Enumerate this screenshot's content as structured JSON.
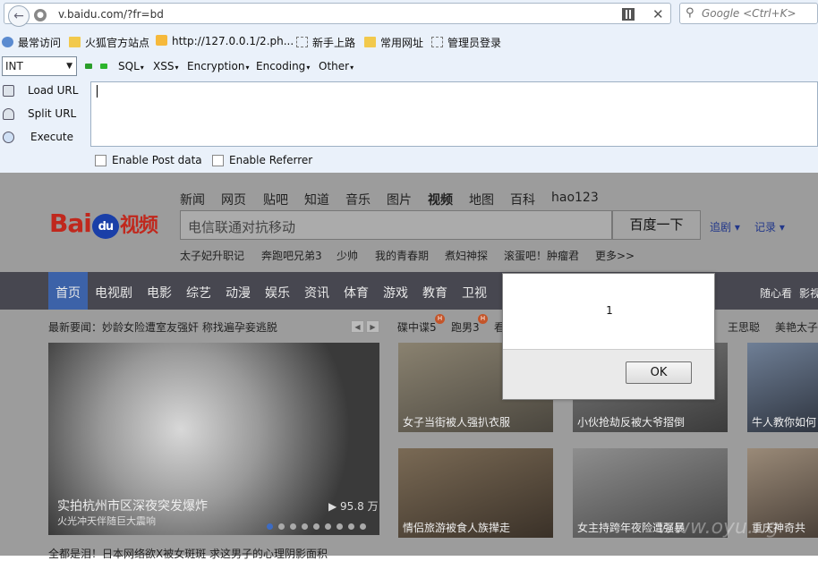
{
  "browser": {
    "url": "v.baidu.com/?fr=bd",
    "search_placeholder": "Google <Ctrl+K>",
    "bookmarks": [
      "最常访问",
      "火狐官方站点",
      "http://127.0.0.1/2.ph...",
      "新手上路",
      "常用网址",
      "管理员登录"
    ]
  },
  "hackbar": {
    "type_select": "INT",
    "menus": [
      "SQL",
      "XSS",
      "Encryption",
      "Encoding",
      "Other"
    ],
    "load_url": "Load URL",
    "split_url": "Split URL",
    "execute": "Execute",
    "textarea_value": "",
    "enable_post": "Enable Post data",
    "enable_referrer": "Enable Referrer"
  },
  "page": {
    "top_nav": [
      "新闻",
      "网页",
      "贴吧",
      "知道",
      "音乐",
      "图片",
      "视频",
      "地图",
      "百科",
      "hao123"
    ],
    "logo": {
      "bai": "Bai",
      "du": "du",
      "shipin": "视频"
    },
    "search_value": "电信联通对抗移动",
    "search_button": "百度一下",
    "link_zhuiju": "追剧 ▾",
    "link_jilu": "记录 ▾",
    "hot_searches": [
      "太子妃升职记",
      "奔跑吧兄弟3",
      "少帅",
      "我的青春期",
      "煮妇神探",
      "滚蛋吧！肿瘤君",
      "更多>>"
    ],
    "channels": [
      "首页",
      "电视剧",
      "电影",
      "综艺",
      "动漫",
      "娱乐",
      "资讯",
      "体育",
      "游戏",
      "教育",
      "卫视"
    ],
    "channels_right": [
      "随心看",
      "影视"
    ],
    "headline": "最新要闻：妙龄女险遭室友强奸 称找遍孕妾逃脱",
    "right_tabs": [
      "碟中谍5",
      "跑男3",
      "看",
      "王思聪",
      "美艳太子"
    ],
    "badge": "H",
    "feature": {
      "title": "实拍杭州市区深夜突发爆炸",
      "subtitle": "火光冲天伴随巨大震响",
      "views": "95.8 万"
    },
    "thumbs": [
      "女子当街被人强扒衣服",
      "小伙抢劫反被大爷摺倒",
      "牛人教你如何",
      "情侣旅游被食人族撵走",
      "女主持跨年夜险遭强暴",
      "重庆神奇共"
    ],
    "bottom_line": "全都是泪！日本网络欲X被女斑斑 求这男子的心理阴影面积",
    "watermark": "www.oyu...g"
  },
  "dialog": {
    "message": "1",
    "ok_label": "OK"
  }
}
